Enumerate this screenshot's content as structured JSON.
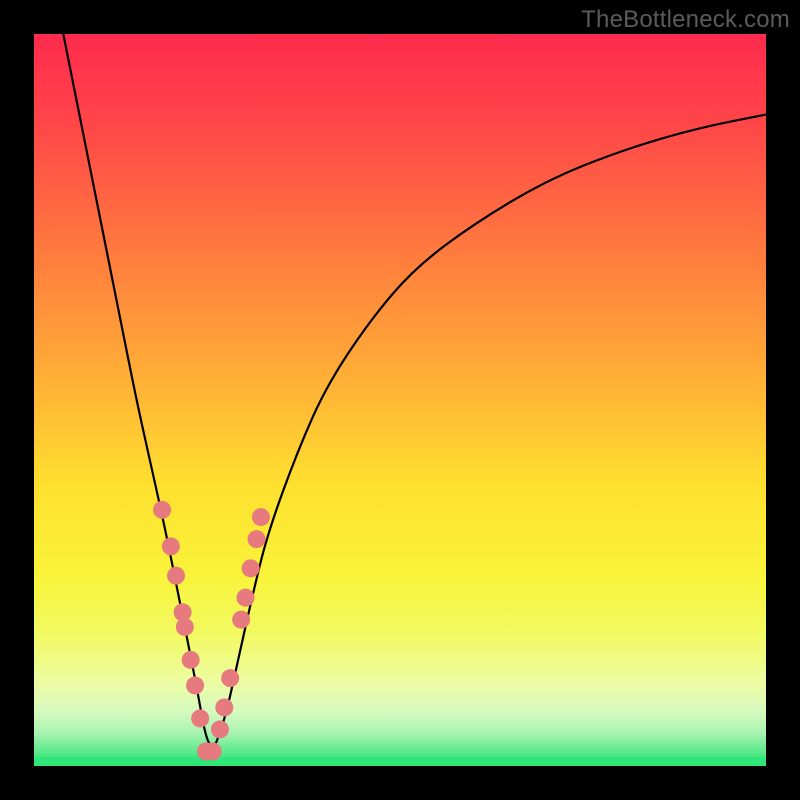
{
  "watermark": "TheBottleneck.com",
  "colors": {
    "frame": "#000000",
    "curve": "#000000",
    "markers": "#e77a7e",
    "green_band": "#2fe678"
  },
  "chart_data": {
    "type": "line",
    "title": "",
    "xlabel": "",
    "ylabel": "",
    "xlim": [
      0,
      100
    ],
    "ylim": [
      0,
      100
    ],
    "notes": "V-shaped bottleneck curve on a vertical red→orange→yellow→green gradient. Minimum (0% bottleneck) near x≈24. Pink markers cluster along the curve near the bottom of the V (≈0–35% bottleneck). Thin bright-green band at the very bottom of the gradient.",
    "series": [
      {
        "name": "bottleneck-curve",
        "x": [
          4,
          6,
          8,
          10,
          12,
          14,
          16,
          18,
          20,
          22,
          24,
          26,
          28,
          30,
          32,
          36,
          40,
          46,
          52,
          60,
          70,
          80,
          90,
          100
        ],
        "y": [
          100,
          90,
          80,
          70,
          60,
          50,
          41,
          32,
          22,
          12,
          1,
          6,
          15,
          24,
          32,
          43,
          52,
          61,
          68,
          74,
          80,
          84,
          87,
          89
        ]
      }
    ],
    "markers": {
      "name": "highlighted-points",
      "x": [
        17.5,
        18.7,
        19.4,
        20.3,
        20.6,
        21.4,
        22.0,
        22.7,
        23.5,
        24.4,
        25.4,
        26.0,
        26.8,
        28.3,
        28.9,
        29.6,
        30.4,
        31.0
      ],
      "y": [
        35.0,
        30.0,
        26.0,
        21.0,
        19.0,
        14.5,
        11.0,
        6.5,
        2.0,
        2.0,
        5.0,
        8.0,
        12.0,
        20.0,
        23.0,
        27.0,
        31.0,
        34.0
      ]
    },
    "gradient_stops": [
      {
        "offset": 0.0,
        "color": "#ff2b4d"
      },
      {
        "offset": 0.12,
        "color": "#ff4549"
      },
      {
        "offset": 0.3,
        "color": "#ff7b3e"
      },
      {
        "offset": 0.48,
        "color": "#ffb236"
      },
      {
        "offset": 0.62,
        "color": "#ffe12f"
      },
      {
        "offset": 0.74,
        "color": "#f9f33a"
      },
      {
        "offset": 0.82,
        "color": "#f2fa62"
      },
      {
        "offset": 0.885,
        "color": "#edfca2"
      },
      {
        "offset": 0.925,
        "color": "#d7fabf"
      },
      {
        "offset": 0.955,
        "color": "#a8f4b0"
      },
      {
        "offset": 0.978,
        "color": "#63ea8f"
      },
      {
        "offset": 1.0,
        "color": "#23e272"
      }
    ]
  }
}
